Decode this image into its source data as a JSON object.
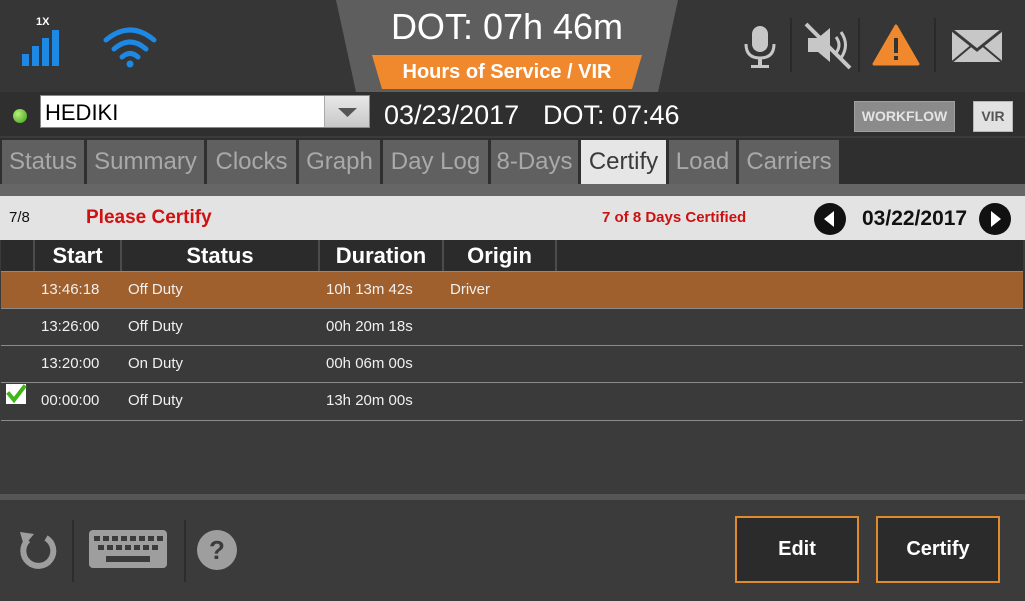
{
  "header": {
    "signal_label": "1X",
    "dot_title": "DOT: 07h 46m",
    "subtitle": "Hours of Service / VIR",
    "accent": "#f0892e",
    "icons": [
      "signal-icon",
      "wifi-icon",
      "microphone-icon",
      "speaker-muted-icon",
      "warning-icon",
      "mail-icon"
    ]
  },
  "driver": {
    "name": "HEDIKI",
    "date": "03/23/2017",
    "dot": "DOT: 07:46",
    "workflow_label": "WORKFLOW",
    "vir_label": "VIR",
    "status_color": "#4caf1c"
  },
  "tabs": [
    {
      "label": "Status",
      "active": false
    },
    {
      "label": "Summary",
      "active": false
    },
    {
      "label": "Clocks",
      "active": false
    },
    {
      "label": "Graph",
      "active": false
    },
    {
      "label": "Day Log",
      "active": false
    },
    {
      "label": "8-Days",
      "active": false
    },
    {
      "label": "Certify",
      "active": true
    },
    {
      "label": "Load",
      "active": false
    },
    {
      "label": "Carriers",
      "active": false
    }
  ],
  "certify": {
    "page_count": "7/8",
    "prompt": "Please Certify",
    "days_certified": "7 of 8 Days Certified",
    "current_date": "03/22/2017"
  },
  "table": {
    "columns": [
      "Start",
      "Status",
      "Duration",
      "Origin"
    ],
    "rows": [
      {
        "start": "13:46:18",
        "status": "Off Duty",
        "duration": "10h 13m 42s",
        "origin": "Driver",
        "selected": true,
        "checked": false
      },
      {
        "start": "13:26:00",
        "status": "Off Duty",
        "duration": "00h 20m 18s",
        "origin": "",
        "selected": false,
        "checked": false
      },
      {
        "start": "13:20:00",
        "status": "On Duty",
        "duration": "00h 06m 00s",
        "origin": "",
        "selected": false,
        "checked": false
      },
      {
        "start": "00:00:00",
        "status": "Off Duty",
        "duration": "13h 20m 00s",
        "origin": "",
        "selected": false,
        "checked": true
      }
    ]
  },
  "footer": {
    "edit_label": "Edit",
    "certify_label": "Certify",
    "icons": [
      "refresh-icon",
      "keyboard-icon",
      "help-icon"
    ],
    "button_border_color": "#e08a30"
  }
}
